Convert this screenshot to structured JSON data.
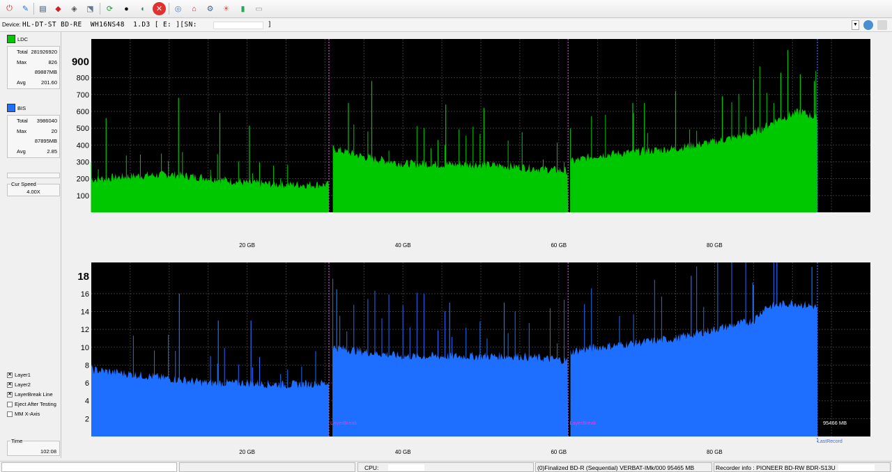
{
  "toolbar": {
    "buttons": [
      "exit-icon",
      "drive-info-icon",
      "benchmark-icon",
      "create-disc-icon",
      "disc-quality-icon",
      "scan-disc-icon",
      "refresh-icon",
      "start-icon",
      "pause-icon",
      "stop-icon",
      "disc-icon",
      "erase-icon",
      "settings-icon",
      "chart-icon",
      "screenshot-icon"
    ]
  },
  "device": {
    "label": "Device:",
    "name": "HL-DT-ST BD-RE  WH16NS48  1.D3 [ E: ][SN:",
    "close": "]"
  },
  "ldc": {
    "label": "LDC",
    "color": "#00c800",
    "stats": [
      {
        "key": "Total",
        "value": "281926920"
      },
      {
        "key": "Max",
        "value": "826"
      },
      {
        "key": "",
        "value": "89887MB"
      },
      {
        "key": "Avg",
        "value": "201.60"
      }
    ]
  },
  "bis": {
    "label": "BIS",
    "color": "#1e6eff",
    "stats": [
      {
        "key": "Total",
        "value": "3986040"
      },
      {
        "key": "Max",
        "value": "20"
      },
      {
        "key": "",
        "value": "87895MB"
      },
      {
        "key": "Avg",
        "value": "2.85"
      }
    ]
  },
  "speed": {
    "label": "Cur Speed",
    "value": "4.00X"
  },
  "options": [
    {
      "label": "Layer1",
      "checked": true
    },
    {
      "label": "Layer2",
      "checked": true
    },
    {
      "label": "LayerBreak Line",
      "checked": true
    },
    {
      "label": "Eject After Testing",
      "checked": false
    },
    {
      "label": "MM X-Axis",
      "checked": false
    }
  ],
  "time": {
    "label": "Time",
    "value": "102:08"
  },
  "chart_data": [
    {
      "type": "area",
      "name": "LDC",
      "ylim": [
        0,
        1030
      ],
      "yticks": [
        "100",
        "200",
        "300",
        "400",
        "500",
        "600",
        "700",
        "800"
      ],
      "top_label": "900",
      "xlim": [
        0,
        100
      ],
      "xticks": [
        {
          "x": 20,
          "label": "20 GB"
        },
        {
          "x": 40,
          "label": "40 GB"
        },
        {
          "x": 60,
          "label": "60 GB"
        },
        {
          "x": 80,
          "label": "80 GB"
        }
      ],
      "layer_breaks": [
        30.5,
        61.2
      ],
      "end_x": 93.2,
      "color": "#00c800",
      "segments": [
        {
          "x": [
            0,
            5,
            10,
            15,
            20,
            25,
            30.5
          ],
          "y": [
            195,
            215,
            225,
            205,
            175,
            165,
            165
          ]
        },
        {
          "x": [
            31,
            35,
            40,
            45,
            50,
            55,
            61.2
          ],
          "y": [
            380,
            330,
            290,
            285,
            285,
            270,
            245
          ]
        },
        {
          "x": [
            61.5,
            65,
            70,
            75,
            80,
            85,
            88,
            91,
            93.2
          ],
          "y": [
            300,
            340,
            360,
            380,
            420,
            470,
            550,
            600,
            560
          ]
        }
      ],
      "spikes": [
        {
          "x": 11.2,
          "y": 680
        },
        {
          "x": 16.5,
          "y": 590
        },
        {
          "x": 20.3,
          "y": 515
        },
        {
          "x": 1.9,
          "y": 560
        },
        {
          "x": 33,
          "y": 650
        },
        {
          "x": 36,
          "y": 780
        },
        {
          "x": 45.5,
          "y": 640
        },
        {
          "x": 50.4,
          "y": 620
        },
        {
          "x": 69.5,
          "y": 650
        },
        {
          "x": 71,
          "y": 650
        },
        {
          "x": 75,
          "y": 720
        },
        {
          "x": 81,
          "y": 690
        },
        {
          "x": 85,
          "y": 790
        },
        {
          "x": 88.5,
          "y": 830
        },
        {
          "x": 91,
          "y": 820
        },
        {
          "x": 92.8,
          "y": 780
        }
      ]
    },
    {
      "type": "area",
      "name": "BIS",
      "ylim": [
        0,
        19.5
      ],
      "yticks": [
        "2",
        "4",
        "6",
        "8",
        "10",
        "12",
        "14",
        "16"
      ],
      "top_label": "18",
      "xlim": [
        0,
        100
      ],
      "xticks": [
        {
          "x": 20,
          "label": "20 GB"
        },
        {
          "x": 40,
          "label": "40 GB"
        },
        {
          "x": 60,
          "label": "60 GB"
        },
        {
          "x": 80,
          "label": "80 GB"
        }
      ],
      "layer_breaks": [
        30.5,
        61.2
      ],
      "layer_break_label": "LayerBreak",
      "end_x": 93.2,
      "end_label": "95466 MB",
      "last_record_label": "LastRecord",
      "color": "#1e6eff",
      "segments": [
        {
          "x": [
            0,
            5,
            10,
            15,
            20,
            25,
            30.5
          ],
          "y": [
            7.5,
            7,
            6.5,
            6,
            6,
            5.8,
            6
          ]
        },
        {
          "x": [
            31,
            35,
            40,
            45,
            50,
            55,
            61.2
          ],
          "y": [
            10,
            9.5,
            9,
            9,
            9,
            9,
            8.5
          ]
        },
        {
          "x": [
            61.5,
            65,
            70,
            75,
            80,
            85,
            86.5,
            90,
            93.2
          ],
          "y": [
            9.5,
            10,
            10.5,
            11,
            12,
            13,
            14.5,
            15,
            14.5
          ]
        }
      ],
      "spikes": [
        {
          "x": 11.3,
          "y": 16
        },
        {
          "x": 16.3,
          "y": 13
        },
        {
          "x": 20.5,
          "y": 13
        },
        {
          "x": 31.5,
          "y": 16.5
        },
        {
          "x": 46,
          "y": 15
        },
        {
          "x": 53,
          "y": 15
        },
        {
          "x": 77,
          "y": 18
        },
        {
          "x": 85,
          "y": 17
        },
        {
          "x": 88,
          "y": 19.5
        },
        {
          "x": 92.5,
          "y": 19
        }
      ]
    }
  ],
  "status": {
    "cpu_label": "CPU:",
    "disc_info": "(0)Finalized  BD-R (Sequential)  VERBAT-IMk/000  95465 MB",
    "recorder_info": "Recorder info : PIONEER      BD-RW  BDR-S13U"
  }
}
